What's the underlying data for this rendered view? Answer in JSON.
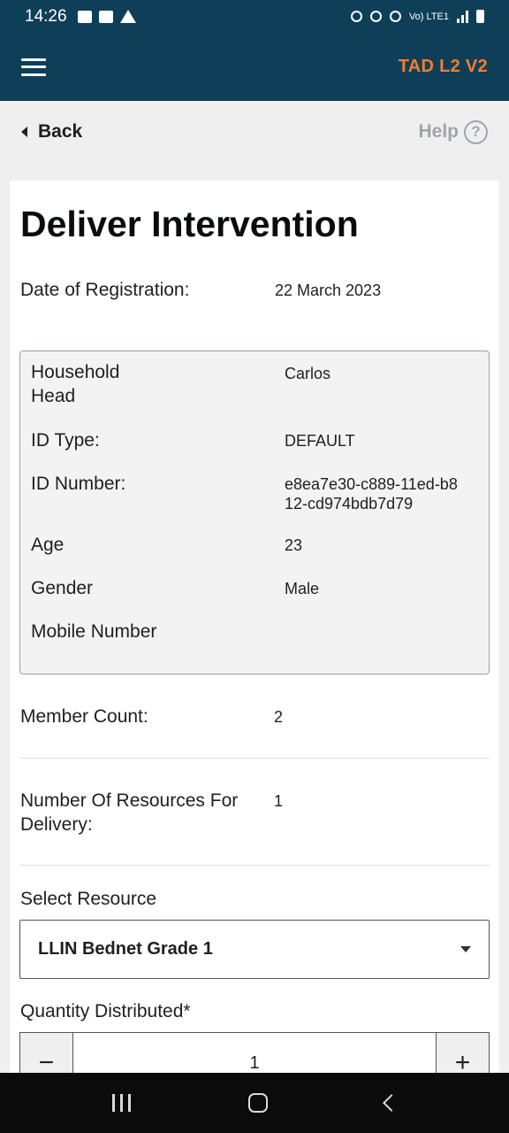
{
  "status_bar": {
    "time": "14:26",
    "network_label": "Vo) LTE1",
    "icons": [
      "gallery-icon",
      "youtube-icon",
      "warning-icon",
      "download-icon",
      "alarm-icon",
      "location-icon",
      "wifi-icon",
      "signal-icon",
      "battery-icon"
    ]
  },
  "app_bar": {
    "title": "TAD L2 V2",
    "title_color": "#f47d30",
    "background": "#0f3f58"
  },
  "nav": {
    "back_label": "Back",
    "help_label": "Help",
    "help_glyph": "?"
  },
  "form": {
    "title": "Deliver Intervention",
    "date_label": "Date of Registration:",
    "date_value": "22 March 2023",
    "household": {
      "head_label": "Household Head",
      "head_value": "Carlos",
      "id_type_label": "ID Type:",
      "id_type_value": "DEFAULT",
      "id_number_label": "ID Number:",
      "id_number_value": "e8ea7e30-c889-11ed-b812-cd974bdb7d79",
      "age_label": "Age",
      "age_value": "23",
      "gender_label": "Gender",
      "gender_value": "Male",
      "mobile_label": "Mobile Number",
      "mobile_value": ""
    },
    "member_count_label": "Member Count:",
    "member_count_value": "2",
    "resources_label": "Number Of Resources For Delivery:",
    "resources_value": "1",
    "select_resource_label": "Select Resource",
    "select_resource_value": "LLIN Bednet Grade 1",
    "quantity_label": "Quantity Distributed*",
    "quantity_value": "1",
    "minus_glyph": "−",
    "plus_glyph": "+"
  }
}
